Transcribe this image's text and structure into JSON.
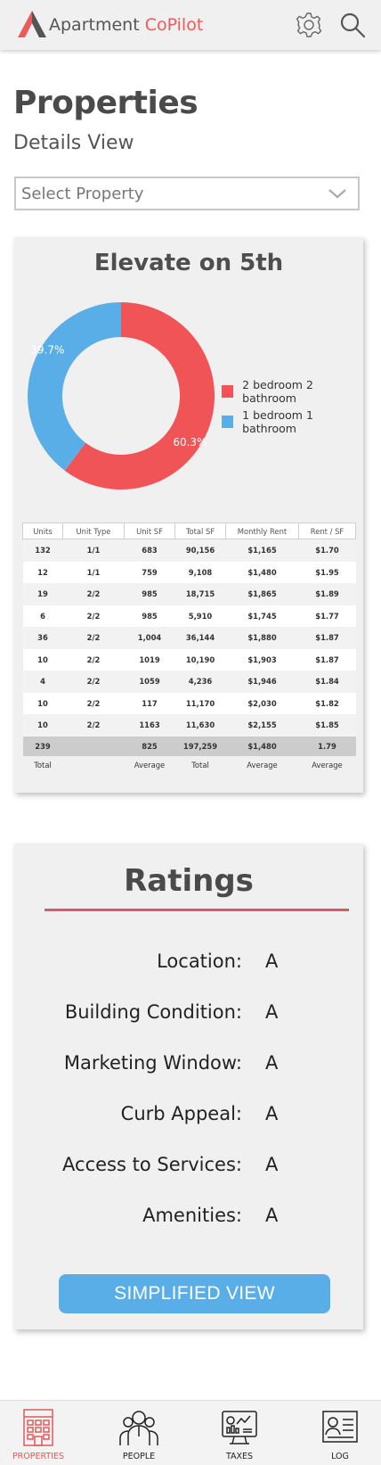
{
  "app": {
    "brand_main": "Apartment",
    "brand_accent": "CoPilot",
    "accent_color": "#ee5a5c",
    "icons": [
      "settings-gear-icon",
      "search-icon"
    ]
  },
  "page": {
    "title": "Properties",
    "subtitle": "Details View"
  },
  "select": {
    "placeholder": "Select Property"
  },
  "property": {
    "name": "Elevate on 5th"
  },
  "chart_data": {
    "type": "pie",
    "categories": [
      "2 bedroom 2 bathroom",
      "1 bedroom 1 bathroom"
    ],
    "values": [
      60.3,
      39.7
    ],
    "labels": [
      "60.3%",
      "39.7%"
    ],
    "colors": [
      "#f05457",
      "#5aaee8"
    ],
    "legend": "right"
  },
  "table": {
    "headers": [
      "Units",
      "Unit Type",
      "Unit SF",
      "Total SF",
      "Monthly Rent",
      "Rent / SF"
    ],
    "rows": [
      [
        "132",
        "1/1",
        "683",
        "90,156",
        "$1,165",
        "$1.70"
      ],
      [
        "12",
        "1/1",
        "759",
        "9,108",
        "$1,480",
        "$1.95"
      ],
      [
        "19",
        "2/2",
        "985",
        "18,715",
        "$1,865",
        "$1.89"
      ],
      [
        "6",
        "2/2",
        "985",
        "5,910",
        "$1,745",
        "$1.77"
      ],
      [
        "36",
        "2/2",
        "1,004",
        "36,144",
        "$1,880",
        "$1.87"
      ],
      [
        "10",
        "2/2",
        "1019",
        "10,190",
        "$1,903",
        "$1.87"
      ],
      [
        "4",
        "2/2",
        "1059",
        "4,236",
        "$1,946",
        "$1.84"
      ],
      [
        "10",
        "2/2",
        "117",
        "11,170",
        "$2,030",
        "$1.82"
      ],
      [
        "10",
        "2/2",
        "1163",
        "11,630",
        "$2,155",
        "$1.85"
      ]
    ],
    "summary": [
      "239",
      "",
      "825",
      "197,259",
      "$1,480",
      "1.79"
    ],
    "footer": [
      "Total",
      "",
      "Average",
      "Total",
      "Average",
      "Average"
    ]
  },
  "ratings": {
    "title": "Ratings",
    "items": [
      {
        "label": "Location:",
        "value": "A"
      },
      {
        "label": "Building Condition:",
        "value": "A"
      },
      {
        "label": "Marketing Window:",
        "value": "A"
      },
      {
        "label": "Curb Appeal:",
        "value": "A"
      },
      {
        "label": "Access to Services:",
        "value": "A"
      },
      {
        "label": "Amenities:",
        "value": "A"
      }
    ],
    "button_label": "SIMPLIFIED VIEW",
    "button_color": "#5aaee8"
  },
  "nav": {
    "items": [
      {
        "label": "PROPERTIES",
        "icon": "building-icon",
        "active": true
      },
      {
        "label": "PEOPLE",
        "icon": "people-icon",
        "active": false
      },
      {
        "label": "TAXES",
        "icon": "monitor-chart-icon",
        "active": false
      },
      {
        "label": "LOG",
        "icon": "id-card-icon",
        "active": false
      }
    ]
  }
}
